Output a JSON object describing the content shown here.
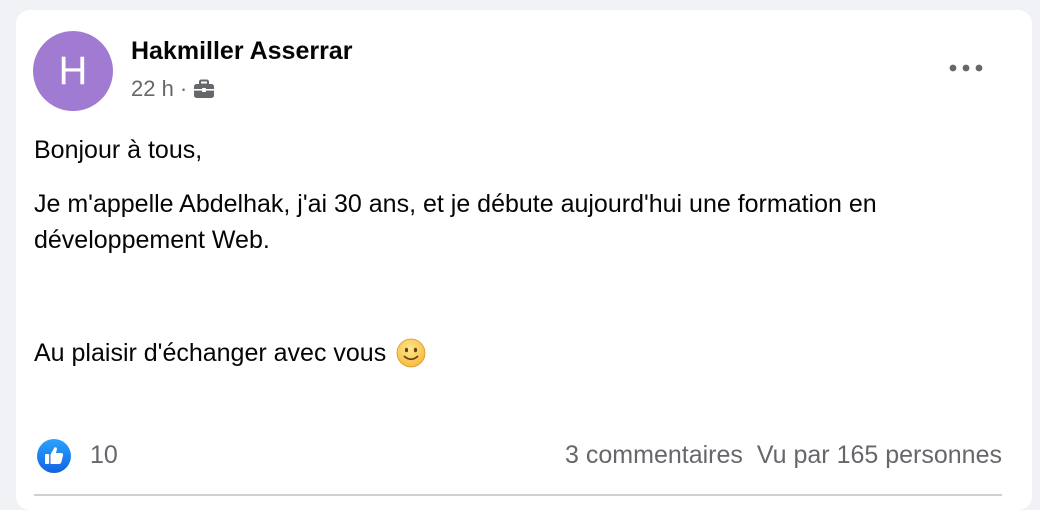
{
  "post": {
    "author": {
      "name": "Hakmiller Asserrar",
      "avatar_letter": "H",
      "avatar_color": "#a17bd1"
    },
    "time": "22 h",
    "separator": "·",
    "audience_icon": "briefcase-icon",
    "more_icon": "ellipsis-icon",
    "paragraphs": [
      "Bonjour à tous,",
      "Je m'appelle Abdelhak, j'ai 30 ans, et je débute aujourd'hui une formation en développement Web.",
      "Au plaisir d'échanger avec vous"
    ],
    "emoji": "slightly-smiling-face-icon",
    "reactions": {
      "icon": "like-icon",
      "icon_color": "#1877f2",
      "count": "10"
    },
    "comments_label": "3 commentaires",
    "seen_by_label": "Vu par 165 personnes"
  }
}
